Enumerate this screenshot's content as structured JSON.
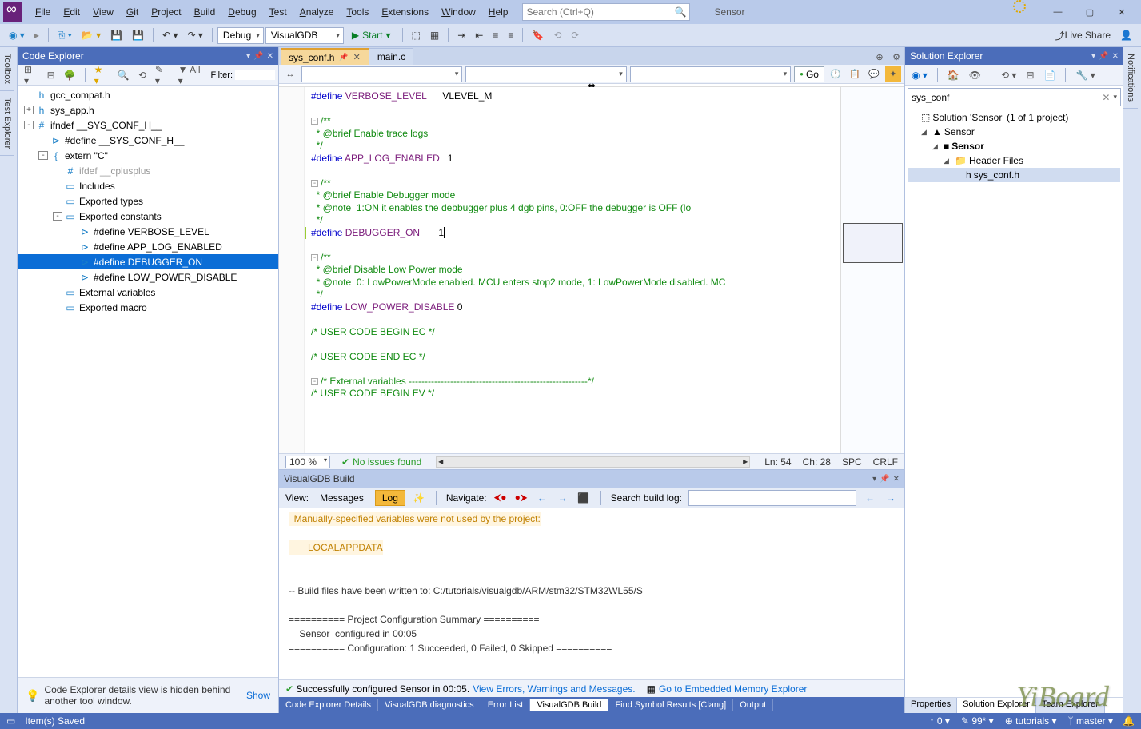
{
  "app_name": "Sensor",
  "menu": [
    "File",
    "Edit",
    "View",
    "Git",
    "Project",
    "Build",
    "Debug",
    "Test",
    "Analyze",
    "Tools",
    "Extensions",
    "Window",
    "Help"
  ],
  "search_placeholder": "Search (Ctrl+Q)",
  "live_share": "Live Share",
  "toolbar": {
    "config": "Debug",
    "platform": "VisualGDB",
    "start": "Start"
  },
  "left_rail": [
    "Toolbox",
    "Test Explorer"
  ],
  "right_rail": [
    "Notifications"
  ],
  "code_explorer": {
    "title": "Code Explorer",
    "filter_label": "Filter:",
    "all_label": "All",
    "hint": "Code Explorer details view is hidden behind another tool window.",
    "show": "Show",
    "tree": [
      {
        "d": 0,
        "exp": "",
        "ico": "h",
        "txt": "gcc_compat.h"
      },
      {
        "d": 0,
        "exp": "+",
        "ico": "h",
        "txt": "sys_app.h"
      },
      {
        "d": 0,
        "exp": "-",
        "ico": "#",
        "txt": "ifndef __SYS_CONF_H__"
      },
      {
        "d": 1,
        "exp": "",
        "ico": "⊳",
        "txt": "#define __SYS_CONF_H__"
      },
      {
        "d": 1,
        "exp": "-",
        "ico": "{",
        "txt": "extern \"C\""
      },
      {
        "d": 2,
        "exp": "",
        "ico": "#",
        "txt": "ifdef __cplusplus",
        "dim": true
      },
      {
        "d": 2,
        "exp": "",
        "ico": "▭",
        "txt": "Includes"
      },
      {
        "d": 2,
        "exp": "",
        "ico": "▭",
        "txt": "Exported types"
      },
      {
        "d": 2,
        "exp": "-",
        "ico": "▭",
        "txt": "Exported constants"
      },
      {
        "d": 3,
        "exp": "",
        "ico": "⊳",
        "txt": "#define VERBOSE_LEVEL"
      },
      {
        "d": 3,
        "exp": "",
        "ico": "⊳",
        "txt": "#define APP_LOG_ENABLED"
      },
      {
        "d": 3,
        "exp": "",
        "ico": "⊳",
        "txt": "#define DEBUGGER_ON",
        "sel": true
      },
      {
        "d": 3,
        "exp": "",
        "ico": "⊳",
        "txt": "#define LOW_POWER_DISABLE"
      },
      {
        "d": 2,
        "exp": "",
        "ico": "▭",
        "txt": "External variables"
      },
      {
        "d": 2,
        "exp": "",
        "ico": "▭",
        "txt": "Exported macro"
      }
    ]
  },
  "tabs": [
    {
      "name": "sys_conf.h",
      "active": true,
      "pinned": true
    },
    {
      "name": "main.c",
      "active": false
    }
  ],
  "go_label": "Go",
  "code_lines": [
    {
      "t": "<span class='kw'>#define</span> <span class='mac'>VERBOSE_LEVEL</span>      VLEVEL_M"
    },
    {
      "t": ""
    },
    {
      "fold": "-",
      "t": "<span class='cmt'>/**</span>"
    },
    {
      "t": "<span class='cmt'>  * @brief Enable trace logs</span>"
    },
    {
      "t": "<span class='cmt'>  */</span>"
    },
    {
      "t": "<span class='kw'>#define</span> <span class='mac'>APP_LOG_ENABLED</span>   1"
    },
    {
      "t": ""
    },
    {
      "fold": "-",
      "t": "<span class='cmt'>/**</span>"
    },
    {
      "t": "<span class='cmt'>  * @brief Enable Debugger mode</span>"
    },
    {
      "t": "<span class='cmt'>  * @note  1:ON it enables the debbugger plus 4 dgb pins, 0:OFF the debugger is OFF (lo</span>"
    },
    {
      "t": "<span class='cmt'>  */</span>"
    },
    {
      "changed": true,
      "t": "<span class='kw'>#define</span> <span class='mac'>DEBUGGER_ON</span>       1<span style='border-left:1px solid #000;'></span>"
    },
    {
      "t": ""
    },
    {
      "fold": "-",
      "t": "<span class='cmt'>/**</span>"
    },
    {
      "t": "<span class='cmt'>  * @brief Disable Low Power mode</span>"
    },
    {
      "t": "<span class='cmt'>  * @note  0: LowPowerMode enabled. MCU enters stop2 mode, 1: LowPowerMode disabled. MC</span>"
    },
    {
      "t": "<span class='cmt'>  */</span>"
    },
    {
      "t": "<span class='kw'>#define</span> <span class='mac'>LOW_POWER_DISABLE</span> 0"
    },
    {
      "t": ""
    },
    {
      "t": "<span class='cmt'>/* USER CODE BEGIN EC */</span>"
    },
    {
      "t": ""
    },
    {
      "t": "<span class='cmt'>/* USER CODE END EC */</span>"
    },
    {
      "t": ""
    },
    {
      "fold": "-",
      "t": "<span class='cmt'>/* External variables --------------------------------------------------------*/</span>"
    },
    {
      "t": "<span class='cmt'>/* USER CODE BEGIN EV */</span>"
    }
  ],
  "status": {
    "zoom": "100 %",
    "issues": "No issues found",
    "ln": "Ln: 54",
    "ch": "Ch: 28",
    "spc": "SPC",
    "eol": "CRLF"
  },
  "build": {
    "title": "VisualGDB Build",
    "view": "View:",
    "messages": "Messages",
    "log": "Log",
    "navigate": "Navigate:",
    "search": "Search build log:",
    "lines": [
      {
        "cls": "warn",
        "t": "  Manually-specified variables were not used by the project:"
      },
      {
        "cls": "",
        "t": ""
      },
      {
        "cls": "warn2",
        "t": "LOCALAPPDATA"
      },
      {
        "cls": "",
        "t": ""
      },
      {
        "cls": "",
        "t": ""
      },
      {
        "cls": "",
        "t": "-- Build files have been written to: C:/tutorials/visualgdb/ARM/stm32/STM32WL55/S"
      },
      {
        "cls": "",
        "t": ""
      },
      {
        "cls": "",
        "t": "========== Project Configuration Summary =========="
      },
      {
        "cls": "",
        "t": "    Sensor  configured in 00:05"
      },
      {
        "cls": "",
        "t": "========== Configuration: 1 Succeeded, 0 Failed, 0 Skipped =========="
      }
    ],
    "footer_ok": "Successfully configured Sensor in 00:05.",
    "footer_link1": "View Errors, Warnings and Messages.",
    "footer_link2": "Go to Embedded Memory Explorer"
  },
  "bottom_tabs": [
    "Code Explorer Details",
    "VisualGDB diagnostics",
    "Error List",
    "VisualGDB Build",
    "Find Symbol Results [Clang]",
    "Output"
  ],
  "bottom_active": "VisualGDB Build",
  "solution_explorer": {
    "title": "Solution Explorer",
    "search": "sys_conf",
    "tree": [
      {
        "d": 0,
        "exp": "",
        "ico": "⬚",
        "txt": "Solution 'Sensor' (1 of 1 project)"
      },
      {
        "d": 1,
        "exp": "◢",
        "ico": "▲",
        "txt": "Sensor",
        "bold": false
      },
      {
        "d": 2,
        "exp": "◢",
        "ico": "■",
        "txt": "Sensor",
        "bold": true
      },
      {
        "d": 3,
        "exp": "◢",
        "ico": "📁",
        "txt": "Header Files"
      },
      {
        "d": 4,
        "exp": "",
        "ico": "h",
        "txt": "sys_conf.h",
        "sel": true
      }
    ],
    "bottom_tabs": [
      "Properties",
      "Solution Explorer",
      "Team Explorer"
    ],
    "bottom_active": "Solution Explorer"
  },
  "statusbar": {
    "left": "Item(s) Saved",
    "items": [
      "↑ 0",
      "✎ 99*",
      "⊕ tutorials",
      "ᛉ master"
    ]
  },
  "watermark": "YiBoard"
}
